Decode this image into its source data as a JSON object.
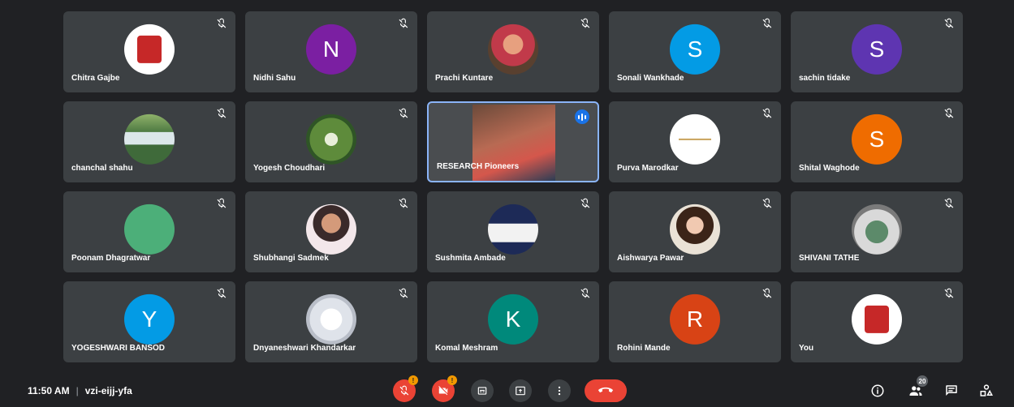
{
  "participants": [
    {
      "name": "Chitra Gajbe",
      "avatar_type": "logo",
      "muted": true
    },
    {
      "name": "Nidhi Sahu",
      "avatar_type": "letter",
      "initial": "N",
      "color": "#7b1fa2",
      "muted": true
    },
    {
      "name": "Prachi Kuntare",
      "avatar_type": "photo",
      "muted": true
    },
    {
      "name": "Sonali Wankhade",
      "avatar_type": "letter",
      "initial": "S",
      "color": "#039be5",
      "muted": true
    },
    {
      "name": "sachin tidake",
      "avatar_type": "letter",
      "initial": "S",
      "color": "#5e35b1",
      "muted": true
    },
    {
      "name": "chanchal shahu",
      "avatar_type": "photo",
      "muted": true
    },
    {
      "name": "Yogesh Choudhari",
      "avatar_type": "photo",
      "muted": true
    },
    {
      "name": "RESEARCH Pioneers",
      "avatar_type": "video",
      "muted": false,
      "speaking": true
    },
    {
      "name": "Purva Marodkar",
      "avatar_type": "photo",
      "muted": true
    },
    {
      "name": "Shital Waghode",
      "avatar_type": "letter",
      "initial": "S",
      "color": "#ef6c00",
      "muted": true
    },
    {
      "name": "Poonam Dhagratwar",
      "avatar_type": "letter",
      "initial": "",
      "color": "#4caf79",
      "muted": true
    },
    {
      "name": "Shubhangi Sadmek",
      "avatar_type": "photo",
      "muted": true
    },
    {
      "name": "Sushmita Ambade",
      "avatar_type": "photo",
      "muted": true
    },
    {
      "name": "Aishwarya Pawar",
      "avatar_type": "photo",
      "muted": true
    },
    {
      "name": "SHIVANI TATHE",
      "avatar_type": "photo",
      "muted": true
    },
    {
      "name": "YOGESHWARI BANSOD",
      "avatar_type": "letter",
      "initial": "Y",
      "color": "#039be5",
      "muted": true
    },
    {
      "name": "Dnyaneshwari Khandarkar",
      "avatar_type": "photo",
      "muted": true
    },
    {
      "name": "Komal Meshram",
      "avatar_type": "letter",
      "initial": "K",
      "color": "#00897b",
      "muted": true
    },
    {
      "name": "Rohini Mande",
      "avatar_type": "letter",
      "initial": "R",
      "color": "#d84315",
      "muted": true
    },
    {
      "name": "You",
      "avatar_type": "logo",
      "muted": true
    }
  ],
  "bottom_bar": {
    "time": "11:50 AM",
    "meeting_code": "vzi-eijj-yfa",
    "people_count": "20",
    "controls": [
      {
        "name": "microphone",
        "icon": "mic-off-icon",
        "state": "off",
        "alert": "!"
      },
      {
        "name": "camera",
        "icon": "camera-off-icon",
        "state": "off",
        "alert": "!"
      },
      {
        "name": "captions",
        "icon": "captions-icon"
      },
      {
        "name": "present",
        "icon": "present-screen-icon"
      },
      {
        "name": "more-options",
        "icon": "more-vert-icon"
      },
      {
        "name": "leave-call",
        "icon": "hang-up-icon"
      }
    ],
    "right_icons": [
      "info-icon",
      "people-icon",
      "chat-icon",
      "activities-icon"
    ]
  },
  "colors": {
    "background": "#202124",
    "tile": "#3c4043",
    "active_border": "#8ab4f8",
    "danger": "#ea4335",
    "alert": "#f29900"
  }
}
